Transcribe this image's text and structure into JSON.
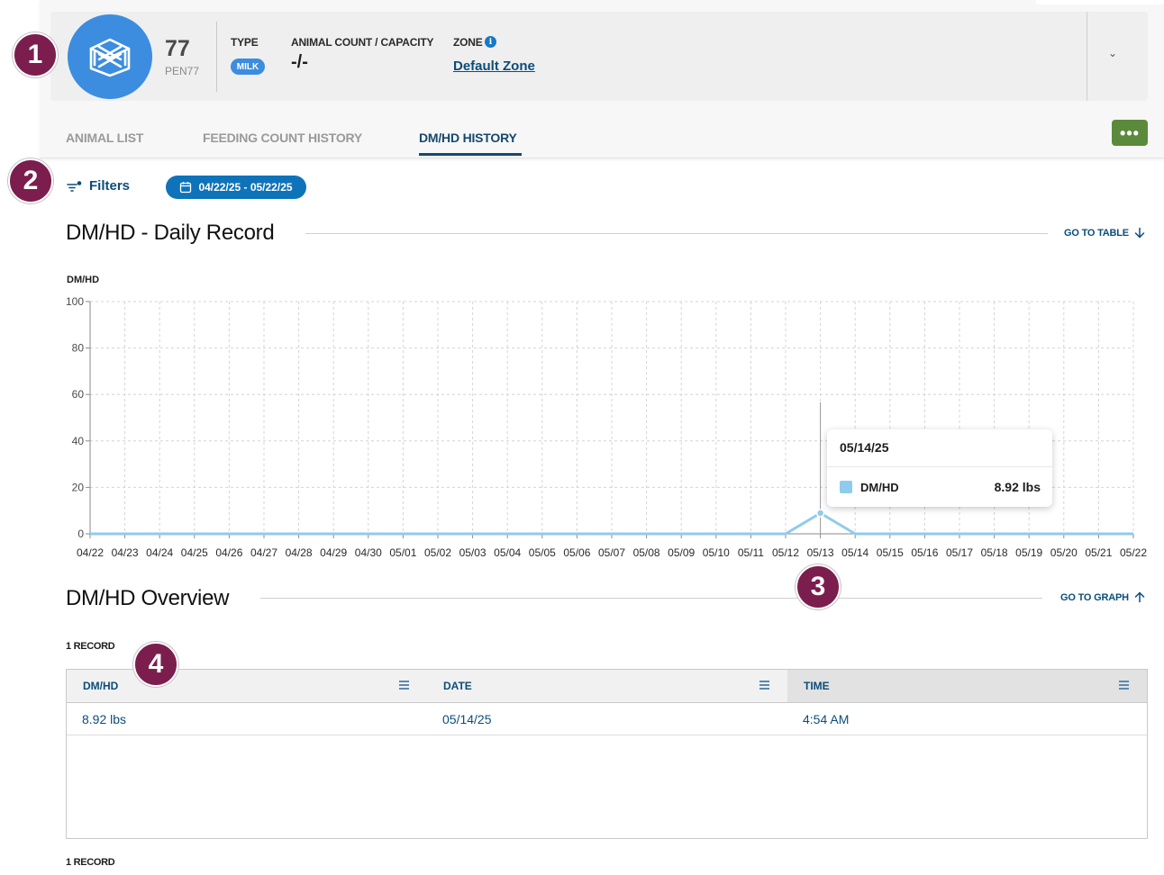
{
  "pen": {
    "number": "77",
    "code": "PEN77",
    "icon": "pen-enclosure-icon",
    "type_label": "TYPE",
    "type_value": "MILK",
    "count_label": "ANIMAL COUNT / CAPACITY",
    "count_value": "-/-",
    "zone_label": "ZONE",
    "zone_value": "Default Zone",
    "zone_info_icon": "i"
  },
  "tabs": [
    {
      "label": "ANIMAL LIST",
      "active": false
    },
    {
      "label": "FEEDING COUNT HISTORY",
      "active": false
    },
    {
      "label": "DM/HD HISTORY",
      "active": true
    }
  ],
  "more_button": "•••",
  "filters": {
    "label": "Filters",
    "date_range": "04/22/25 - 05/22/25"
  },
  "graph_section": {
    "title": "DM/HD - Daily Record",
    "link": "GO TO TABLE",
    "link_icon": "arrow-down-icon"
  },
  "chart_data": {
    "type": "line",
    "ylabel": "DM/HD",
    "ylim": [
      0,
      100
    ],
    "yticks": [
      0,
      20,
      40,
      60,
      80,
      100
    ],
    "grid": true,
    "categories": [
      "04/22",
      "04/23",
      "04/24",
      "04/25",
      "04/26",
      "04/27",
      "04/28",
      "04/29",
      "04/30",
      "05/01",
      "05/02",
      "05/03",
      "05/04",
      "05/05",
      "05/06",
      "05/07",
      "05/08",
      "05/09",
      "05/10",
      "05/11",
      "05/12",
      "05/13",
      "05/14",
      "05/15",
      "05/16",
      "05/17",
      "05/18",
      "05/19",
      "05/20",
      "05/21",
      "05/22"
    ],
    "series": [
      {
        "values": [
          0,
          0,
          0,
          0,
          0,
          0,
          0,
          0,
          0,
          0,
          0,
          0,
          0,
          0,
          0,
          0,
          0,
          0,
          0,
          0,
          0,
          8.92,
          0,
          0,
          0,
          0,
          0,
          0,
          0,
          0,
          0
        ],
        "color": "#8fcbec"
      }
    ],
    "tooltip": {
      "date": "05/14/25",
      "series": "DM/HD",
      "value": "8.92 lbs"
    }
  },
  "overview_section": {
    "title": "DM/HD Overview",
    "link": "GO TO GRAPH",
    "link_icon": "arrow-up-icon"
  },
  "record_count": "1 RECORD",
  "table": {
    "columns": [
      "DM/HD",
      "DATE",
      "TIME"
    ],
    "rows": [
      [
        "8.92 lbs",
        "05/14/25",
        "4:54 AM"
      ]
    ]
  },
  "annotations": [
    "1",
    "2",
    "3",
    "4"
  ],
  "colors": {
    "brand_blue": "#3c8ddf",
    "link_navy": "#0b4d7a",
    "accent_green": "#5c8a3b",
    "annotation": "#7b1e4e",
    "series": "#8fcbec"
  }
}
